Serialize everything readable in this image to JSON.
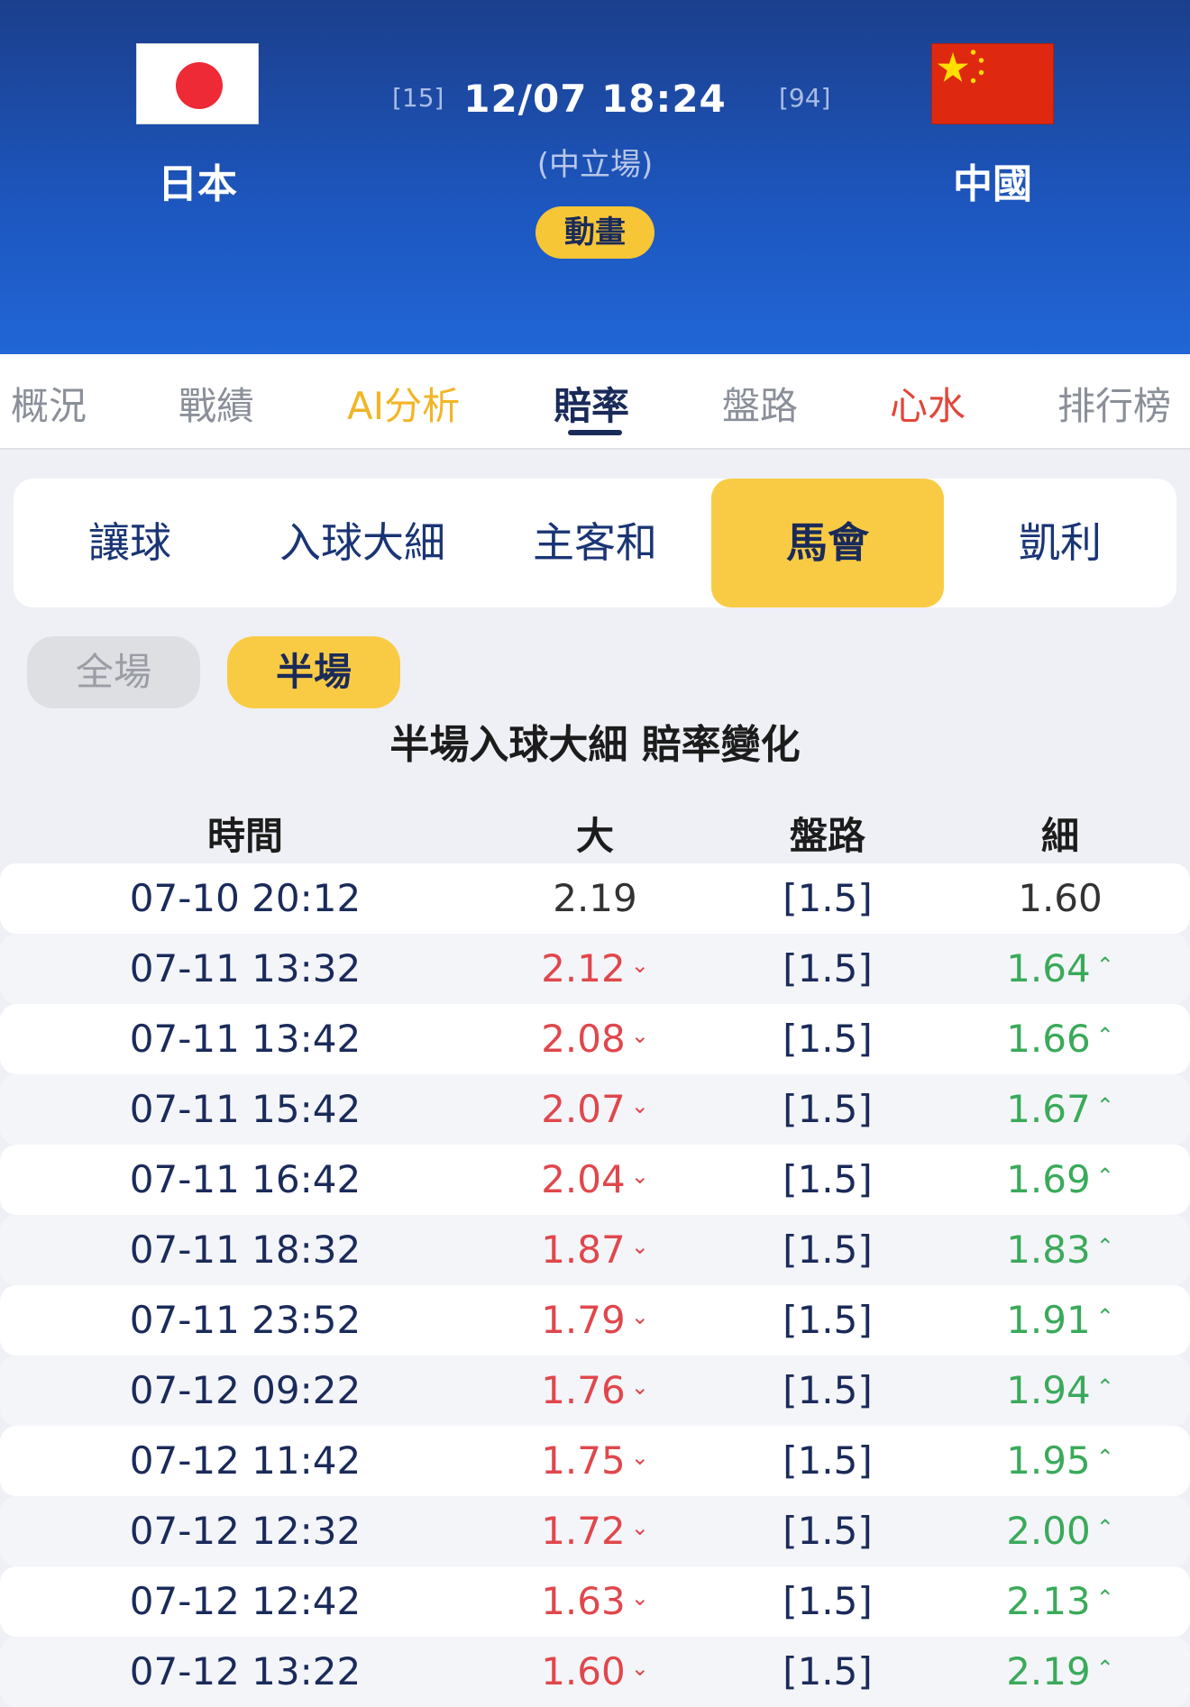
{
  "match": {
    "home_team": "日本",
    "away_team": "中國",
    "home_rank": "[15]",
    "away_rank": "[94]",
    "datetime": "12/07 18:24",
    "venue": "(中立場)",
    "animation_label": "動畫"
  },
  "main_tabs": [
    {
      "label": "概況"
    },
    {
      "label": "戰績"
    },
    {
      "label": "AI分析"
    },
    {
      "label": "賠率"
    },
    {
      "label": "盤路"
    },
    {
      "label": "心水"
    },
    {
      "label": "排行榜"
    }
  ],
  "sub_tabs": [
    {
      "label": "讓球"
    },
    {
      "label": "入球大細"
    },
    {
      "label": "主客和"
    },
    {
      "label": "馬會"
    },
    {
      "label": "凱利"
    }
  ],
  "period": {
    "full": "全場",
    "half": "半場",
    "selected": "半場"
  },
  "section_title": "半場入球大細 賠率變化",
  "table": {
    "headers": [
      "時間",
      "大",
      "盤路",
      "細"
    ],
    "rows": [
      {
        "time": "07-10 20:12",
        "big": "2.19",
        "line": "[1.5]",
        "small": "1.60",
        "big_trend": "none",
        "small_trend": "none"
      },
      {
        "time": "07-11 13:32",
        "big": "2.12",
        "line": "[1.5]",
        "small": "1.64",
        "big_trend": "down",
        "small_trend": "up"
      },
      {
        "time": "07-11 13:42",
        "big": "2.08",
        "line": "[1.5]",
        "small": "1.66",
        "big_trend": "down",
        "small_trend": "up"
      },
      {
        "time": "07-11 15:42",
        "big": "2.07",
        "line": "[1.5]",
        "small": "1.67",
        "big_trend": "down",
        "small_trend": "up"
      },
      {
        "time": "07-11 16:42",
        "big": "2.04",
        "line": "[1.5]",
        "small": "1.69",
        "big_trend": "down",
        "small_trend": "up"
      },
      {
        "time": "07-11 18:32",
        "big": "1.87",
        "line": "[1.5]",
        "small": "1.83",
        "big_trend": "down",
        "small_trend": "up"
      },
      {
        "time": "07-11 23:52",
        "big": "1.79",
        "line": "[1.5]",
        "small": "1.91",
        "big_trend": "down",
        "small_trend": "up"
      },
      {
        "time": "07-12 09:22",
        "big": "1.76",
        "line": "[1.5]",
        "small": "1.94",
        "big_trend": "down",
        "small_trend": "up"
      },
      {
        "time": "07-12 11:42",
        "big": "1.75",
        "line": "[1.5]",
        "small": "1.95",
        "big_trend": "down",
        "small_trend": "up"
      },
      {
        "time": "07-12 12:32",
        "big": "1.72",
        "line": "[1.5]",
        "small": "2.00",
        "big_trend": "down",
        "small_trend": "up"
      },
      {
        "time": "07-12 12:42",
        "big": "1.63",
        "line": "[1.5]",
        "small": "2.13",
        "big_trend": "down",
        "small_trend": "up"
      },
      {
        "time": "07-12 13:22",
        "big": "1.60",
        "line": "[1.5]",
        "small": "2.19",
        "big_trend": "down",
        "small_trend": "up"
      }
    ]
  },
  "icons": {
    "down": "double-chevron-down-icon",
    "up": "double-chevron-up-icon"
  },
  "colors": {
    "header": "#1d57c0",
    "accent": "#f9cb45",
    "down": "#e0474c",
    "up": "#3aaa5a"
  }
}
